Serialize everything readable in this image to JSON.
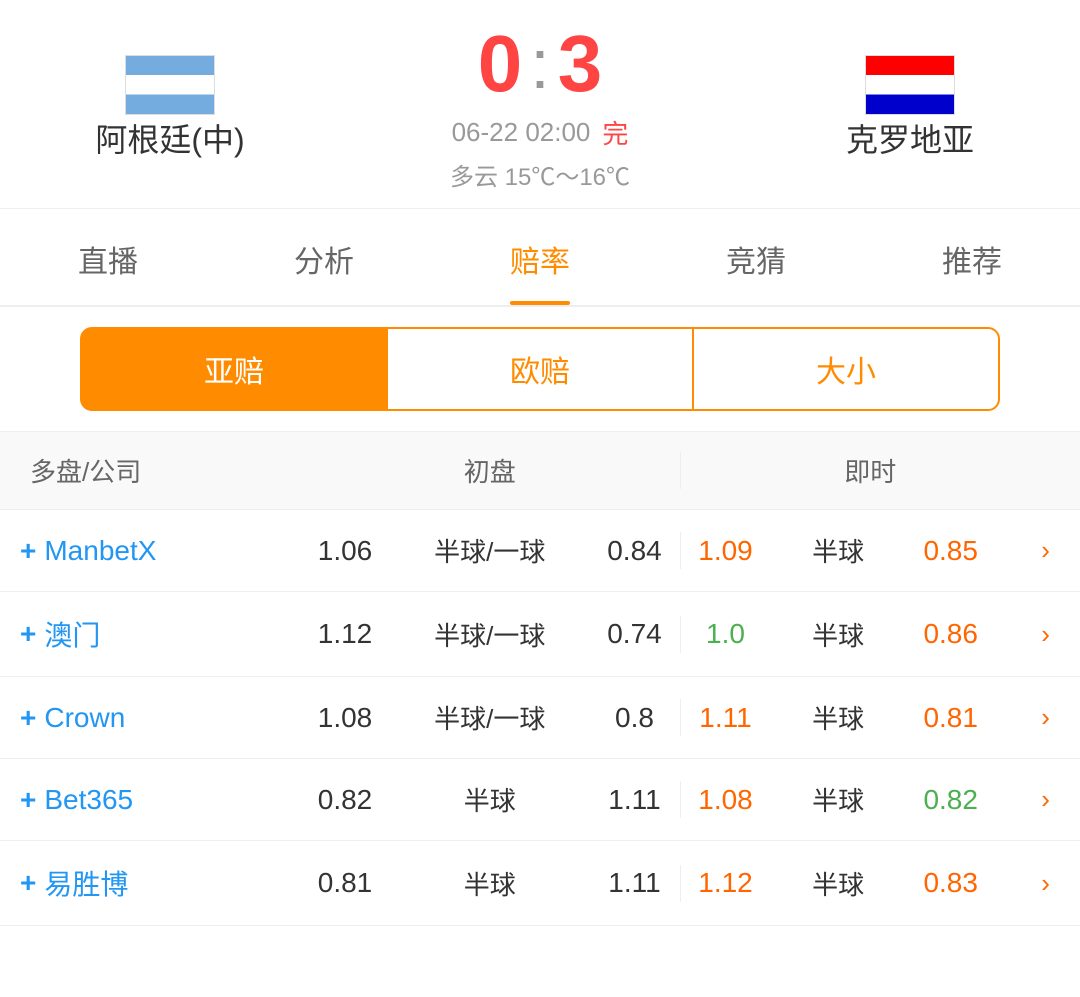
{
  "header": {
    "team_home": "阿根廷(中)",
    "team_away": "克罗地亚",
    "score_home": "0",
    "score_away": "3",
    "score_colon": ":",
    "match_date": "06-22 02:00",
    "match_status": "完",
    "weather": "多云  15℃～16℃"
  },
  "nav": {
    "tabs": [
      "直播",
      "分析",
      "赔率",
      "竞猜",
      "推荐"
    ],
    "active": 2
  },
  "sub_tabs": {
    "items": [
      "亚赔",
      "欧赔",
      "大小"
    ],
    "active": 0
  },
  "table": {
    "headers": {
      "company": "多盘/公司",
      "initial": "初盘",
      "realtime": "即时"
    },
    "rows": [
      {
        "company": "ManbetX",
        "init_home": "1.06",
        "init_handicap": "半球/一球",
        "init_away": "0.84",
        "rt_home": "1.09",
        "rt_home_color": "orange",
        "rt_handicap": "半球",
        "rt_away": "0.85",
        "rt_away_color": "orange"
      },
      {
        "company": "澳门",
        "init_home": "1.12",
        "init_handicap": "半球/一球",
        "init_away": "0.74",
        "rt_home": "1.0",
        "rt_home_color": "green",
        "rt_handicap": "半球",
        "rt_away": "0.86",
        "rt_away_color": "orange"
      },
      {
        "company": "Crown",
        "init_home": "1.08",
        "init_handicap": "半球/一球",
        "init_away": "0.8",
        "rt_home": "1.11",
        "rt_home_color": "orange",
        "rt_handicap": "半球",
        "rt_away": "0.81",
        "rt_away_color": "orange"
      },
      {
        "company": "Bet365",
        "init_home": "0.82",
        "init_handicap": "半球",
        "init_away": "1.11",
        "rt_home": "1.08",
        "rt_home_color": "orange",
        "rt_handicap": "半球",
        "rt_away": "0.82",
        "rt_away_color": "green"
      },
      {
        "company": "易胜博",
        "init_home": "0.81",
        "init_handicap": "半球",
        "init_away": "1.11",
        "rt_home": "1.12",
        "rt_home_color": "orange",
        "rt_handicap": "半球",
        "rt_away": "0.83",
        "rt_away_color": "orange"
      }
    ]
  }
}
